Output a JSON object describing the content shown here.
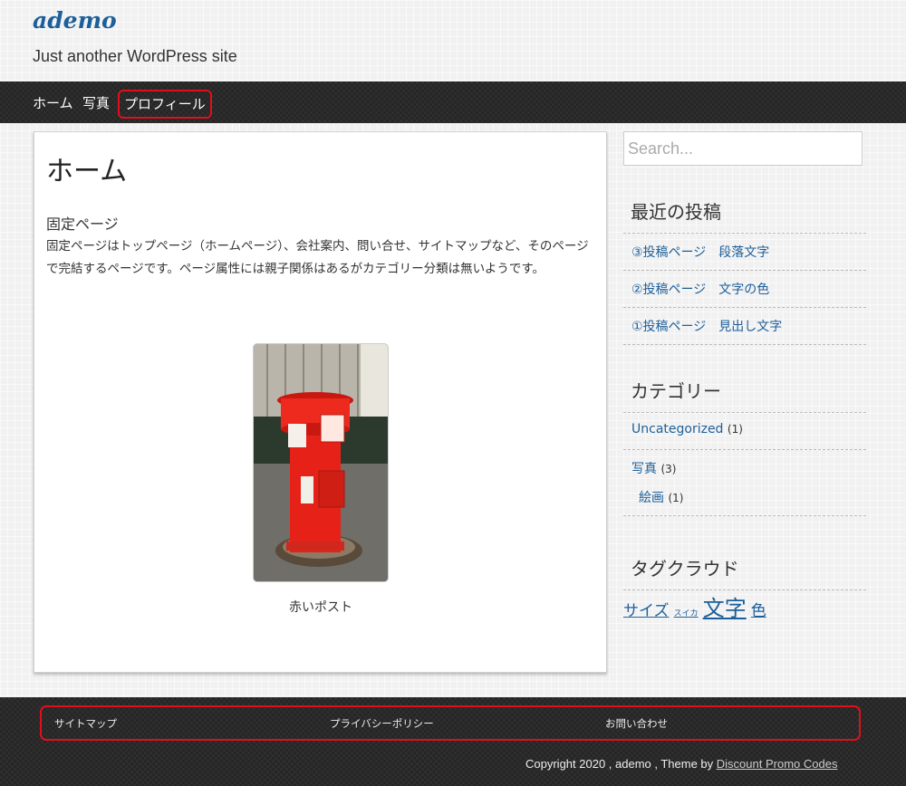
{
  "site": {
    "title": "ademo",
    "description": "Just another WordPress site"
  },
  "nav": {
    "items": [
      {
        "label": "ホーム"
      },
      {
        "label": "写真"
      },
      {
        "label": "プロフィール"
      }
    ]
  },
  "main": {
    "title": "ホーム",
    "section_heading": "固定ページ",
    "body": "固定ページはトップページ（ホームページ）、会社案内、問い合せ、サイトマップなど、そのページで完結するページです。ページ属性には親子関係はあるがカテゴリー分類は無いようです。",
    "image_caption": "赤いポスト"
  },
  "sidebar": {
    "search_placeholder": "Search...",
    "recent_title": "最近の投稿",
    "recent_posts": [
      "③投稿ページ　段落文字",
      "②投稿ページ　文字の色",
      "①投稿ページ　見出し文字"
    ],
    "categories_title": "カテゴリー",
    "categories": [
      {
        "name": "Uncategorized",
        "count": "(1)"
      },
      {
        "name": "写真",
        "count": "(3)"
      },
      {
        "name": "絵画",
        "count": "(1)"
      }
    ],
    "tags_title": "タグクラウド",
    "tags": [
      "サイズ",
      "スイカ",
      "文字",
      "色"
    ]
  },
  "footer": {
    "menu": [
      "サイトマップ",
      "プライバシーポリシー",
      "お問い合わせ"
    ],
    "copyright_prefix": "Copyright 2020 , ademo , Theme by",
    "copyright_link": "Discount Promo Codes"
  },
  "colors": {
    "link": "#1d5f9a",
    "highlight_border": "#e0101a",
    "dark_bar": "#262626"
  }
}
